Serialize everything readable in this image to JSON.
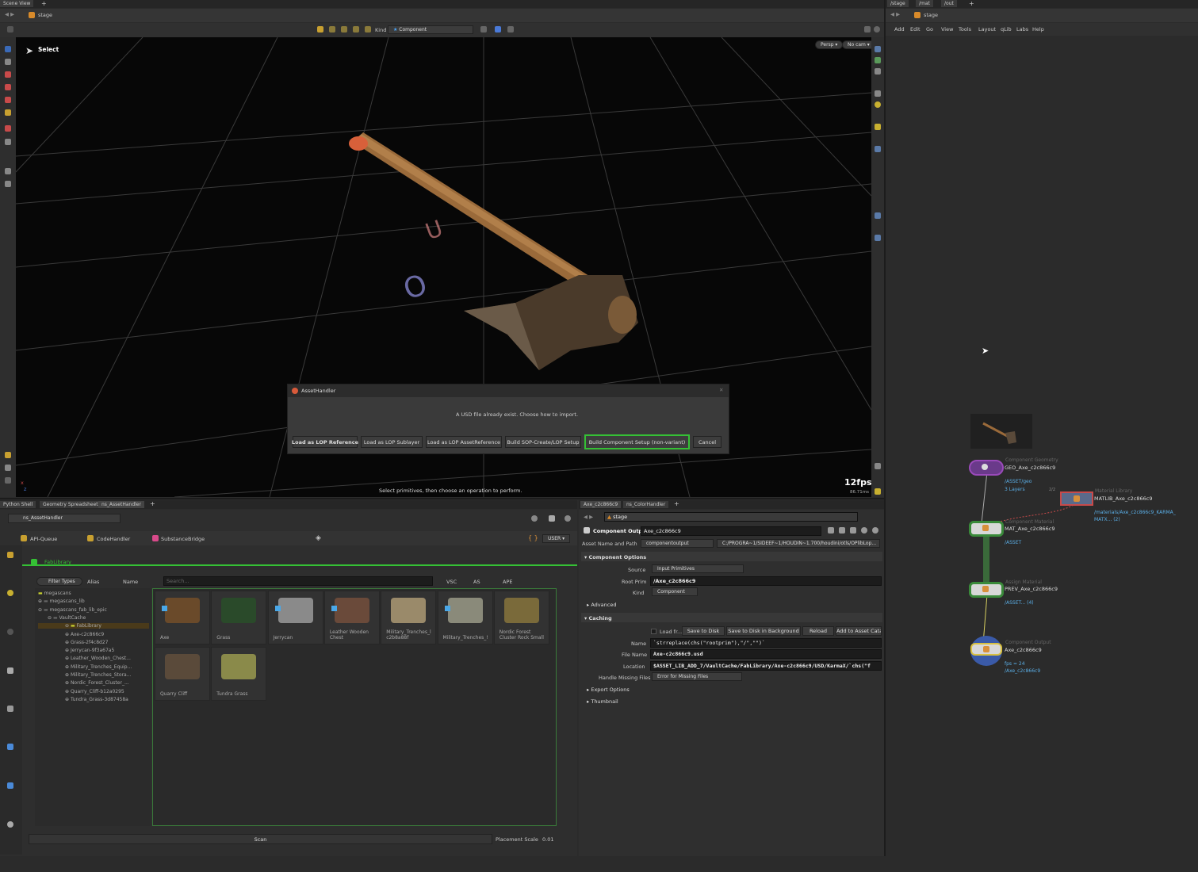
{
  "top_tabs": {
    "scene_view": "Scene View",
    "stage": "/stage",
    "mat": "/mat",
    "out": "/out"
  },
  "viewport": {
    "path": "stage",
    "tool_label": "Select",
    "kind_label": "Kind",
    "kind_value": "Component",
    "persp": "Persp ▾",
    "cam": "No cam ▾",
    "fps": "12fps",
    "ms": "86.71ms",
    "hint": "Select primitives, then choose an operation to perform.",
    "axis_x": "x",
    "axis_z": "z"
  },
  "dialog": {
    "title": "AssetHandler",
    "message": "A USD file already exist. Choose how to import.",
    "buttons": [
      "Load as LOP Reference",
      "Load as LOP Sublayer",
      "Load as LOP AssetReference",
      "Build SOP-Create/LOP Setup",
      "Build Component Setup (non-variant)",
      "Cancel"
    ]
  },
  "network_menu": [
    "Add",
    "Edit",
    "Go",
    "View",
    "Tools",
    "Layout",
    "qLib",
    "Labs",
    "Help"
  ],
  "network": {
    "path": "stage",
    "nodes": {
      "geo": {
        "type": "Component Geometry",
        "name": "GEO_Axe_c2c866c9",
        "sub1": "/ASSET/geo",
        "sub2": "3 Layers"
      },
      "matlib": {
        "type": "Material Library",
        "name": "MATLIB_Axe_c2c866c9",
        "sub1": "/materials/Axe_c2c866c9_KARMA_",
        "sub2": "MATX... (2)",
        "badge": "2/2"
      },
      "mat": {
        "type": "Component Material",
        "name": "MAT_Axe_c2c866c9",
        "sub1": "/ASSET"
      },
      "prev": {
        "type": "Assign Material",
        "name": "PREV_Axe_c2c866c9",
        "sub1": "/ASSET... (4)"
      },
      "out": {
        "type": "Component Output",
        "name": "Axe_c2c866c9",
        "sub1": "fps = 24",
        "sub2": "/Axe_c2c866c9"
      }
    }
  },
  "bottom_left_tabs": [
    "Python Shell",
    "Geometry Spreadsheet",
    "ns_AssetHandler"
  ],
  "asset_handler": {
    "dropdown": "ns_AssetHandler",
    "tools": [
      "API-Queue",
      "CodeHandler",
      "SubstanceBridge"
    ],
    "user": "USER ▾",
    "braces": "{ }",
    "library_tab": "FabLibrary",
    "filter": "Filter Types",
    "alias": "Alias",
    "name_col": "Name",
    "search_placeholder": "Search...",
    "col_vsc": "VSC",
    "col_as": "AS",
    "col_ape": "APE",
    "tree": [
      "megascans",
      "megascans_lib",
      "megascans_fab_lib_epic",
      "VaultCache",
      "FabLibrary",
      "Axe-c2c866c9",
      "Grass-2f4c8d27",
      "Jerrycan-9f3a67a5",
      "Leather_Wooden_Chest...",
      "Military_Trenches_Equip...",
      "Military_Trenches_Stora...",
      "Nordic_Forest_Cluster_...",
      "Quarry_Cliff-b12a0295",
      "Tundra_Grass-3d87458a"
    ],
    "tiles": [
      "Axe",
      "Grass",
      "Jerrycan",
      "Leather Wooden Chest",
      "Military_Trenches_l c2b8a88f",
      "Military_Trenches_!",
      "Nordic Forest Cluster Rock Small",
      "Quarry Cliff",
      "Tundra Grass"
    ],
    "scan": "Scan",
    "placement_label": "Placement Scale",
    "placement_value": "0.01"
  },
  "params_tabs": [
    "Axe_c2c866c9",
    "ns_ColorHandler"
  ],
  "params": {
    "path": "stage",
    "node_type": "Component Output",
    "node_name": "Axe_c2c866c9",
    "asset_name_label": "Asset Name and Path",
    "asset_name_value": "componentoutput",
    "asset_path_value": "C:/PROGRA~1/SIDEEF~1/HOUDIN~1.700/houdini/otls/OPlibLop...",
    "component_options": "Component Options",
    "source_label": "Source",
    "source_value": "Input Primitives",
    "root_prim_label": "Root Prim",
    "root_prim_value": "/Axe_c2c866c9",
    "kind_label": "Kind",
    "kind_value": "Component",
    "advanced": "Advanced",
    "caching": "Caching",
    "load_from": "Load fr...",
    "save_buttons": [
      "Save to Disk",
      "Save to Disk in Background",
      "Reload",
      "Add to Asset Cata"
    ],
    "name_label": "Name",
    "name_value": "`strreplace(chs(\"rootprim\"),\"/\",\"\")`",
    "file_name_label": "File Name",
    "file_name_value": "Axe-c2c866c9.usd",
    "location_label": "Location",
    "location_value": "$ASSET_LIB_ADD_7/VaultCache/FabLibrary/Axe-c2c866c9/USD/KarmaX/`chs(\"f",
    "handle_label": "Handle Missing Files",
    "handle_value": "Error for Missing Files",
    "export_options": "Export Options",
    "thumbnail": "Thumbnail"
  },
  "colors": {
    "accent_green": "#35c035",
    "node_blue": "#5aaee6",
    "dialog_bg": "#3c3c3c"
  }
}
